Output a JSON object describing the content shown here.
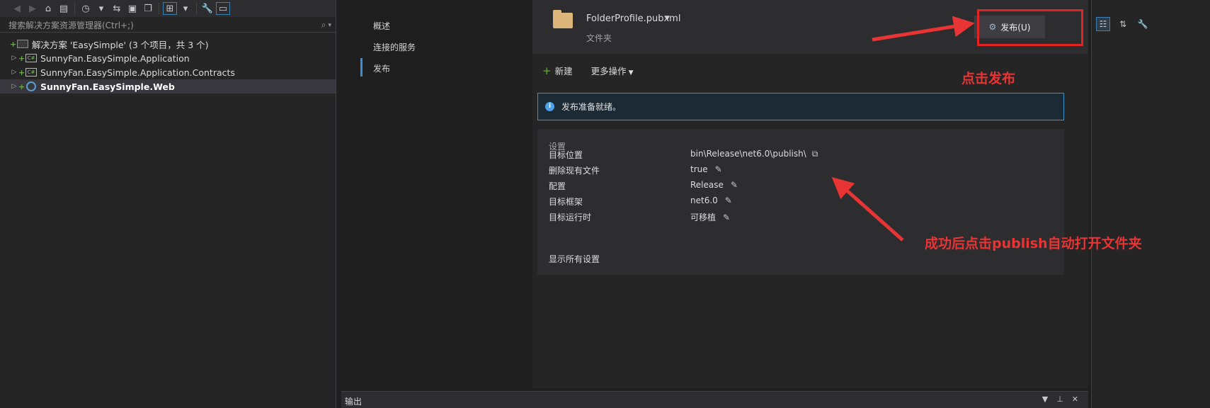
{
  "solution_explorer": {
    "search_placeholder": "搜索解决方案资源管理器(Ctrl+;)",
    "solution_label": "解决方案 'EasySimple' (3 个项目，共 3 个)",
    "projects": [
      {
        "name": "SunnyFan.EasySimple.Application",
        "icon": "csharp-project-icon",
        "bold": false
      },
      {
        "name": "SunnyFan.EasySimple.Application.Contracts",
        "icon": "csharp-project-icon",
        "bold": false
      },
      {
        "name": "SunnyFan.EasySimple.Web",
        "icon": "web-project-icon",
        "bold": true
      }
    ]
  },
  "publish_nav": {
    "items": [
      "概述",
      "连接的服务",
      "发布"
    ],
    "selected": "发布"
  },
  "profile": {
    "name": "FolderProfile.pubxml",
    "type": "文件夹",
    "publish_button": "发布(U)"
  },
  "actions": {
    "new_label": "新建",
    "more_label": "更多操作"
  },
  "info": {
    "message": "发布准备就绪。"
  },
  "settings": {
    "header": "设置",
    "rows": [
      {
        "key": "目标位置",
        "value": "bin\\Release\\net6.0\\publish\\"
      },
      {
        "key": "删除现有文件",
        "value": "true"
      },
      {
        "key": "配置",
        "value": "Release"
      },
      {
        "key": "目标框架",
        "value": "net6.0"
      },
      {
        "key": "目标运行时",
        "value": "可移植"
      }
    ],
    "show_all": "显示所有设置"
  },
  "output_panel": {
    "title": "输出"
  },
  "annotations": {
    "click_publish": "点击发布",
    "after_success": "成功后点击publish自动打开文件夹",
    "color": "#e83434"
  }
}
